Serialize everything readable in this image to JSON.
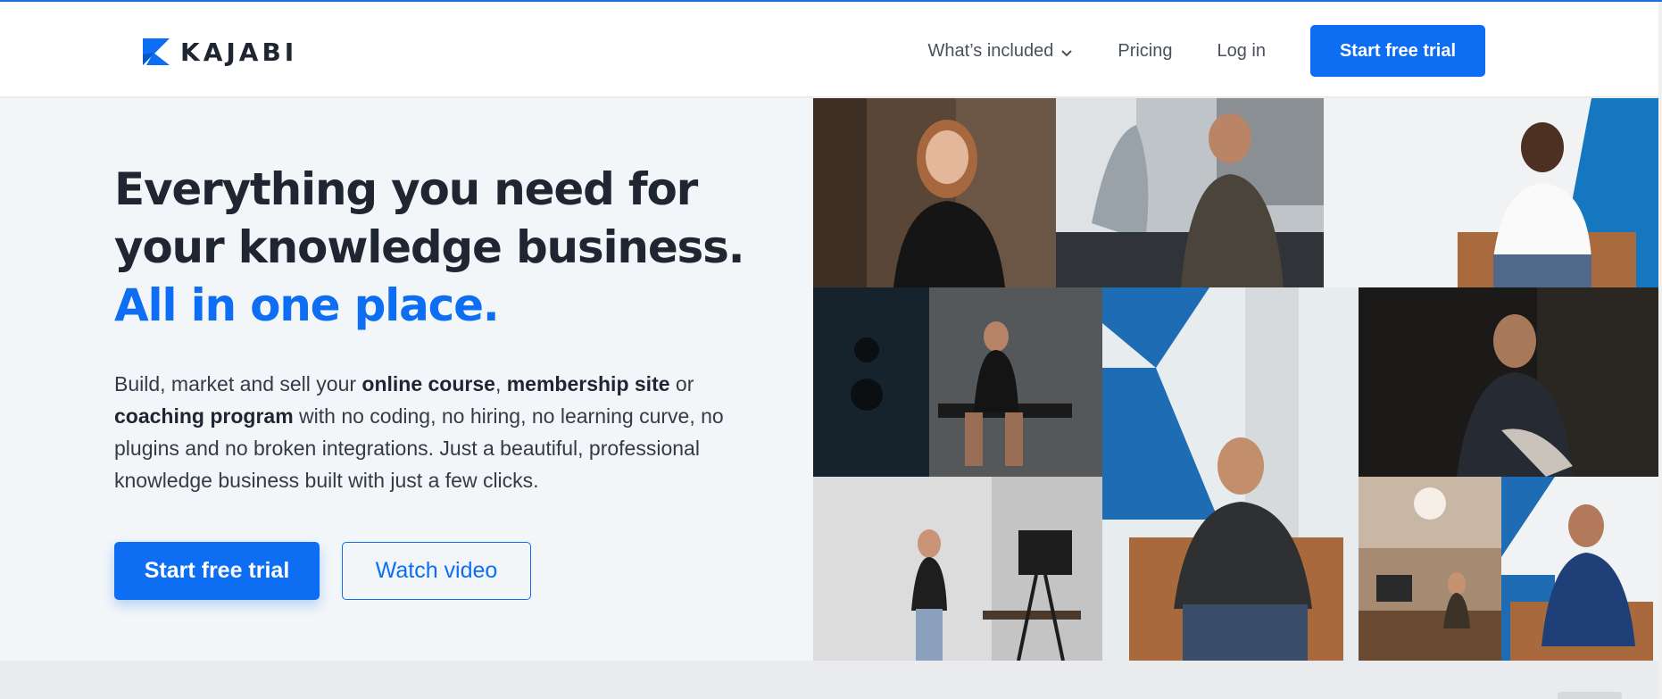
{
  "header": {
    "logo_text": "KAJABI",
    "nav": [
      {
        "label": "What’s included",
        "has_dropdown": true
      },
      {
        "label": "Pricing"
      },
      {
        "label": "Log in"
      }
    ],
    "cta_label": "Start free trial"
  },
  "hero": {
    "headline_line1": "Everything you need for",
    "headline_line2": "your knowledge business.",
    "headline_accent": "All in one place.",
    "body": {
      "p1": "Build, market and sell your ",
      "b1": "online course",
      "p2": ", ",
      "b2": "membership site",
      "p3": " or ",
      "b3": "coaching program",
      "p4": " with no coding, no hiring, no learning curve, no plugins and no broken integrations. Just a beautiful, professional knowledge business built with just a few clicks."
    },
    "primary_cta": "Start free trial",
    "secondary_cta": "Watch video"
  },
  "colors": {
    "brand_blue": "#0d6ef4",
    "dark_text": "#1f2631",
    "hero_bg": "#f3f6f9"
  },
  "photos": [
    {
      "name": "woman-smiling-photo"
    },
    {
      "name": "man-on-motorcycle-photo"
    },
    {
      "name": "man-in-chair-speaking-photo"
    },
    {
      "name": "woman-gym-bench-photo"
    },
    {
      "name": "man-glasses-in-chair-photo"
    },
    {
      "name": "man-seated-dark-photo"
    },
    {
      "name": "woman-filming-studio-photo"
    },
    {
      "name": "woman-desk-office-photo"
    },
    {
      "name": "man-blue-shirt-seated-photo"
    }
  ]
}
